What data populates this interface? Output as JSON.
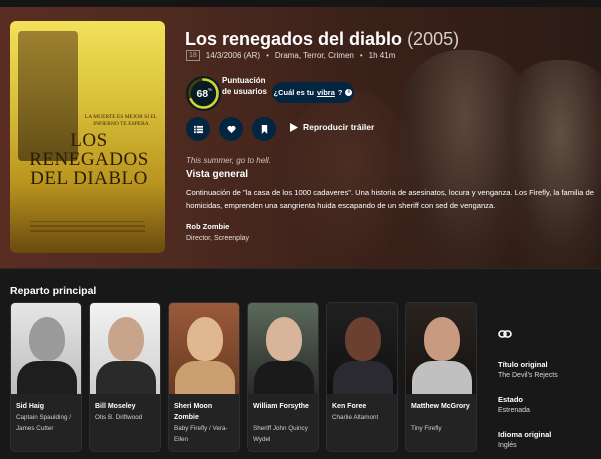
{
  "movie": {
    "title": "Los renegados del diablo",
    "year": "(2005)",
    "certification": "18",
    "release": "14/3/2006 (AR)",
    "genres": "Drama, Terror, Crimen",
    "runtime": "1h 41m",
    "score": "68",
    "score_unit": "%",
    "score_fraction": 0.68,
    "score_label": "Puntuación de usuarios",
    "vibe_prefix": "¿Cuál es tu",
    "vibe_word": "vibra",
    "vibe_suffix": "?",
    "vibe_info_glyph": "i",
    "trailer_label": "Reproducir tráiler",
    "tagline": "This summer, go to hell.",
    "overview_heading": "Vista general",
    "overview": "Continuación de \"la casa de los 1000 cadaveres\". Una historia de asesinatos, locura y venganza. Los Firefly, la familia de homicidas, emprenden una sangrienta huida escapando de un sheriff con sed de venganza.",
    "crew_name": "Rob Zombie",
    "crew_job": "Director, Screenplay"
  },
  "poster": {
    "tag": "La muerte es mejor si el infierno te espera",
    "title": "Los Renegados del Diablo"
  },
  "actions": [
    {
      "name": "list",
      "icon": "list-icon"
    },
    {
      "name": "favorite",
      "icon": "heart-icon"
    },
    {
      "name": "watchlist",
      "icon": "bookmark-icon"
    }
  ],
  "cast_heading": "Reparto principal",
  "cast": [
    {
      "name": "Sid Haig",
      "role": "Captain Spaulding / James Cutter"
    },
    {
      "name": "Bill Moseley",
      "role": "Otis B. Driftwood"
    },
    {
      "name": "Sheri Moon Zombie",
      "role": "Baby Firefly / Vera-Ellen"
    },
    {
      "name": "William Forsythe",
      "role": "Sheriff John Quincy Wydel"
    },
    {
      "name": "Ken Foree",
      "role": "Charlie Altamont"
    },
    {
      "name": "Matthew McGrory",
      "role": "Tiny Firefly"
    }
  ],
  "facts": {
    "original_title_label": "Título original",
    "original_title": "The Devil's Rejects",
    "status_label": "Estado",
    "status": "Estrenada",
    "language_label": "Idioma original",
    "language": "Inglés"
  },
  "colors": {
    "score_ring": "#d2d531",
    "score_track": "#423d0f",
    "button_bg": "#032541"
  }
}
